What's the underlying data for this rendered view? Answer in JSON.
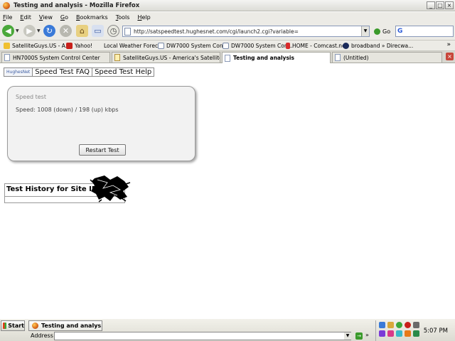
{
  "window": {
    "title": "Testing and analysis - Mozilla Firefox"
  },
  "menubar": {
    "items": [
      "File",
      "Edit",
      "View",
      "Go",
      "Bookmarks",
      "Tools",
      "Help"
    ]
  },
  "navbar": {
    "url": "http://satspeedtest.hughesnet.com/cgi/launch2.cgi?variable=",
    "go_label": "Go"
  },
  "bookmarks": [
    {
      "label": "SatelliteGuys.US - A...",
      "icon_color": "#f0c030"
    },
    {
      "label": "Yahoo!",
      "icon_color": "#c8201a"
    },
    {
      "label": "Local Weather Forec...",
      "icon_color": ""
    },
    {
      "label": "DW7000 System Con...",
      "icon_color": "#ffffff"
    },
    {
      "label": "DW7000 System Con...",
      "icon_color": "#ffffff"
    },
    {
      "label": "HOME - Comcast.net",
      "icon_color": "#d82a2a"
    },
    {
      "label": "broadband » Direcwa...",
      "icon_color": "#1a2a5a"
    }
  ],
  "tabs": [
    {
      "label": "HN7000S System Control Center",
      "active": false
    },
    {
      "label": "SatelliteGuys.US - America's Satellite Infor...",
      "active": false
    },
    {
      "label": "Testing and analysis",
      "active": true
    },
    {
      "label": "(Untitled)",
      "active": false
    }
  ],
  "page": {
    "hughes_logo": "HughesNet",
    "faq_link": "Speed Test FAQ",
    "help_link": "Speed Test Help",
    "panel_title": "Speed test",
    "speed_text": "Speed: 1008 (down) / 198 (up) kbps",
    "restart_label": "Restart Test",
    "history_title": "Test History for Site ID:"
  },
  "taskbar": {
    "start_label": "Start",
    "task_label": "Testing and analys...",
    "address_label": "Address",
    "clock": "5:07 PM"
  },
  "colors": {
    "accent": "#3a9a2a",
    "tab_close": "#c8463a"
  }
}
